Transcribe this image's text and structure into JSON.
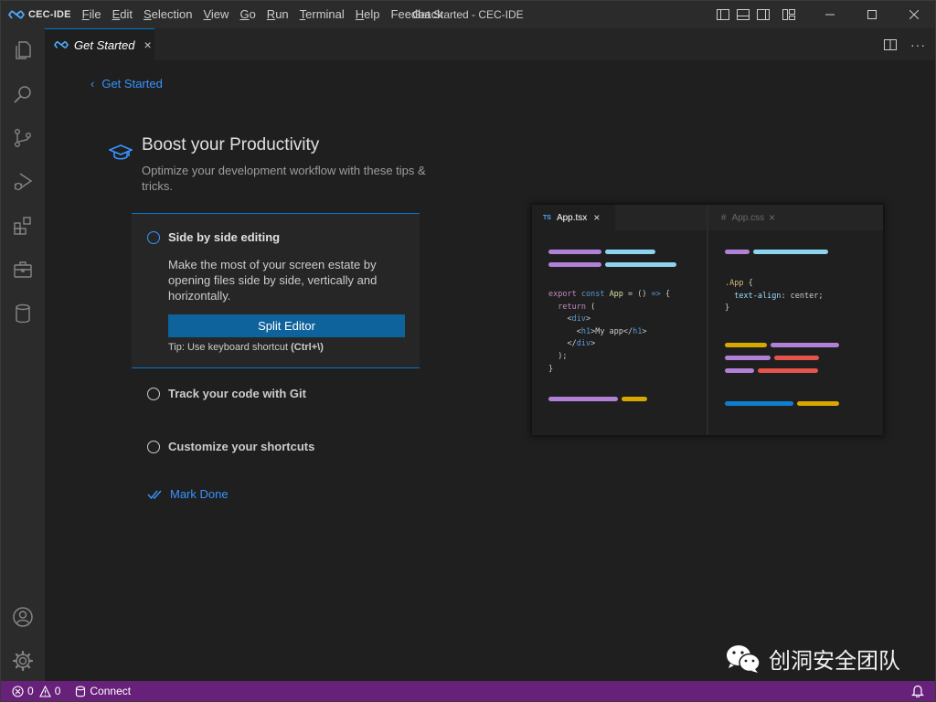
{
  "app": {
    "brand": "CEC-IDE",
    "window_title": "Get Started - CEC-IDE",
    "accent": "#0078d4",
    "status_color": "#68217a"
  },
  "menu": [
    {
      "label": "File",
      "mnemonic": "F",
      "rest": "ile"
    },
    {
      "label": "Edit",
      "mnemonic": "E",
      "rest": "dit"
    },
    {
      "label": "Selection",
      "mnemonic": "S",
      "rest": "election"
    },
    {
      "label": "View",
      "mnemonic": "V",
      "rest": "iew"
    },
    {
      "label": "Go",
      "mnemonic": "G",
      "rest": "o"
    },
    {
      "label": "Run",
      "mnemonic": "R",
      "rest": "un"
    },
    {
      "label": "Terminal",
      "mnemonic": "T",
      "rest": "erminal"
    },
    {
      "label": "Help",
      "mnemonic": "H",
      "rest": "elp"
    },
    {
      "label": "Feedback",
      "mnemonic": "",
      "rest": "Feedback"
    }
  ],
  "activity_icons": [
    "explorer-icon",
    "search-icon",
    "source-control-icon",
    "run-debug-icon",
    "extensions-icon",
    "toolbox-icon",
    "database-icon"
  ],
  "activity_bottom_icons": [
    "account-icon",
    "settings-gear-icon"
  ],
  "tab": {
    "label": "Get Started",
    "close": "×"
  },
  "editor": {
    "back_link": "Get Started",
    "heading": "Boost your Productivity",
    "subheading": "Optimize your development workflow with these tips & tricks.",
    "active_step": {
      "title": "Side by side editing",
      "description": "Make the most of your screen estate by opening files side by side, vertically and horizontally.",
      "button": "Split Editor",
      "tip_prefix": "Tip: Use keyboard shortcut ",
      "tip_shortcut": "(Ctrl+\\)"
    },
    "steps": [
      {
        "title": "Track your code with Git"
      },
      {
        "title": "Customize your shortcuts"
      }
    ],
    "mark_done": "Mark Done"
  },
  "preview": {
    "tab1": {
      "badge": "TS",
      "label": "App.tsx",
      "close": "×"
    },
    "tab2": {
      "badge": "#",
      "label": "App.css",
      "close": "×"
    }
  },
  "watermark": "创洞安全团队",
  "status": {
    "errors": "0",
    "warnings": "0",
    "connect": "Connect"
  }
}
